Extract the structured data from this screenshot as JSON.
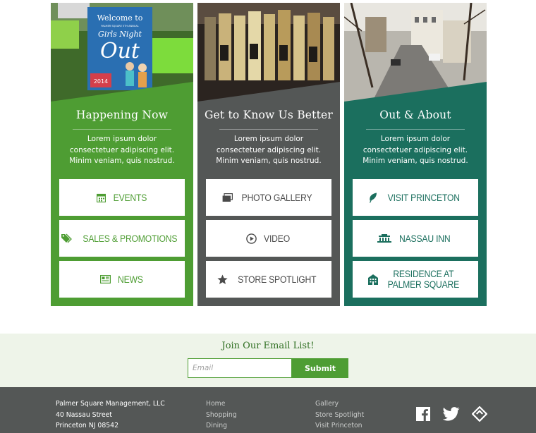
{
  "columns": [
    {
      "title": "Happening Now",
      "body": [
        "Lorem ipsum dolor",
        "consectetuer adipiscing elit.",
        "Minim veniam, quis nostrud."
      ],
      "buttons": [
        {
          "label": "Events",
          "icon": "calendar-icon"
        },
        {
          "label": "Sales & Promotions",
          "icon": "tag-icon"
        },
        {
          "label": "News",
          "icon": "newspaper-icon"
        }
      ],
      "photo": {
        "sign_lines": [
          "Welcome to",
          "PALMER SQUARE 5TH ANNUAL",
          "Girls Night",
          "Out",
          "2014"
        ]
      },
      "color": "#4e9d33"
    },
    {
      "title": "Get to Know Us Better",
      "body": [
        "Lorem ipsum dolor",
        "consectetuer adipiscing elit.",
        "Minim veniam, quis nostrud."
      ],
      "buttons": [
        {
          "label": "Photo Gallery",
          "icon": "gallery-icon"
        },
        {
          "label": "Video",
          "icon": "play-icon"
        },
        {
          "label": "Store Spotlight",
          "icon": "star-icon"
        }
      ],
      "color": "#545756"
    },
    {
      "title": "Out & About",
      "body": [
        "Lorem ipsum dolor",
        "consectetuer adipiscing elit.",
        "Minim veniam, quis nostrud."
      ],
      "buttons": [
        {
          "label": "Visit Princeton",
          "icon": "leaf-icon"
        },
        {
          "label": "Nassau Inn",
          "icon": "inn-icon"
        },
        {
          "label_lines": [
            "Residence at",
            "Palmer Square"
          ],
          "icon": "building-icon"
        }
      ],
      "color": "#1b6f5e"
    }
  ],
  "email": {
    "title": "Join Our Email List!",
    "placeholder": "Email",
    "submit_label": "Submit"
  },
  "footer": {
    "address": [
      "Palmer Square Management, LLC",
      "40 Nassau Street",
      "Princeton NJ 08542"
    ],
    "nav1": [
      "Home",
      "Shopping",
      "Dining"
    ],
    "nav2": [
      "Gallery",
      "Store Spotlight",
      "Visit Princeton"
    ],
    "social": [
      "facebook-icon",
      "twitter-icon",
      "foursquare-icon"
    ]
  }
}
